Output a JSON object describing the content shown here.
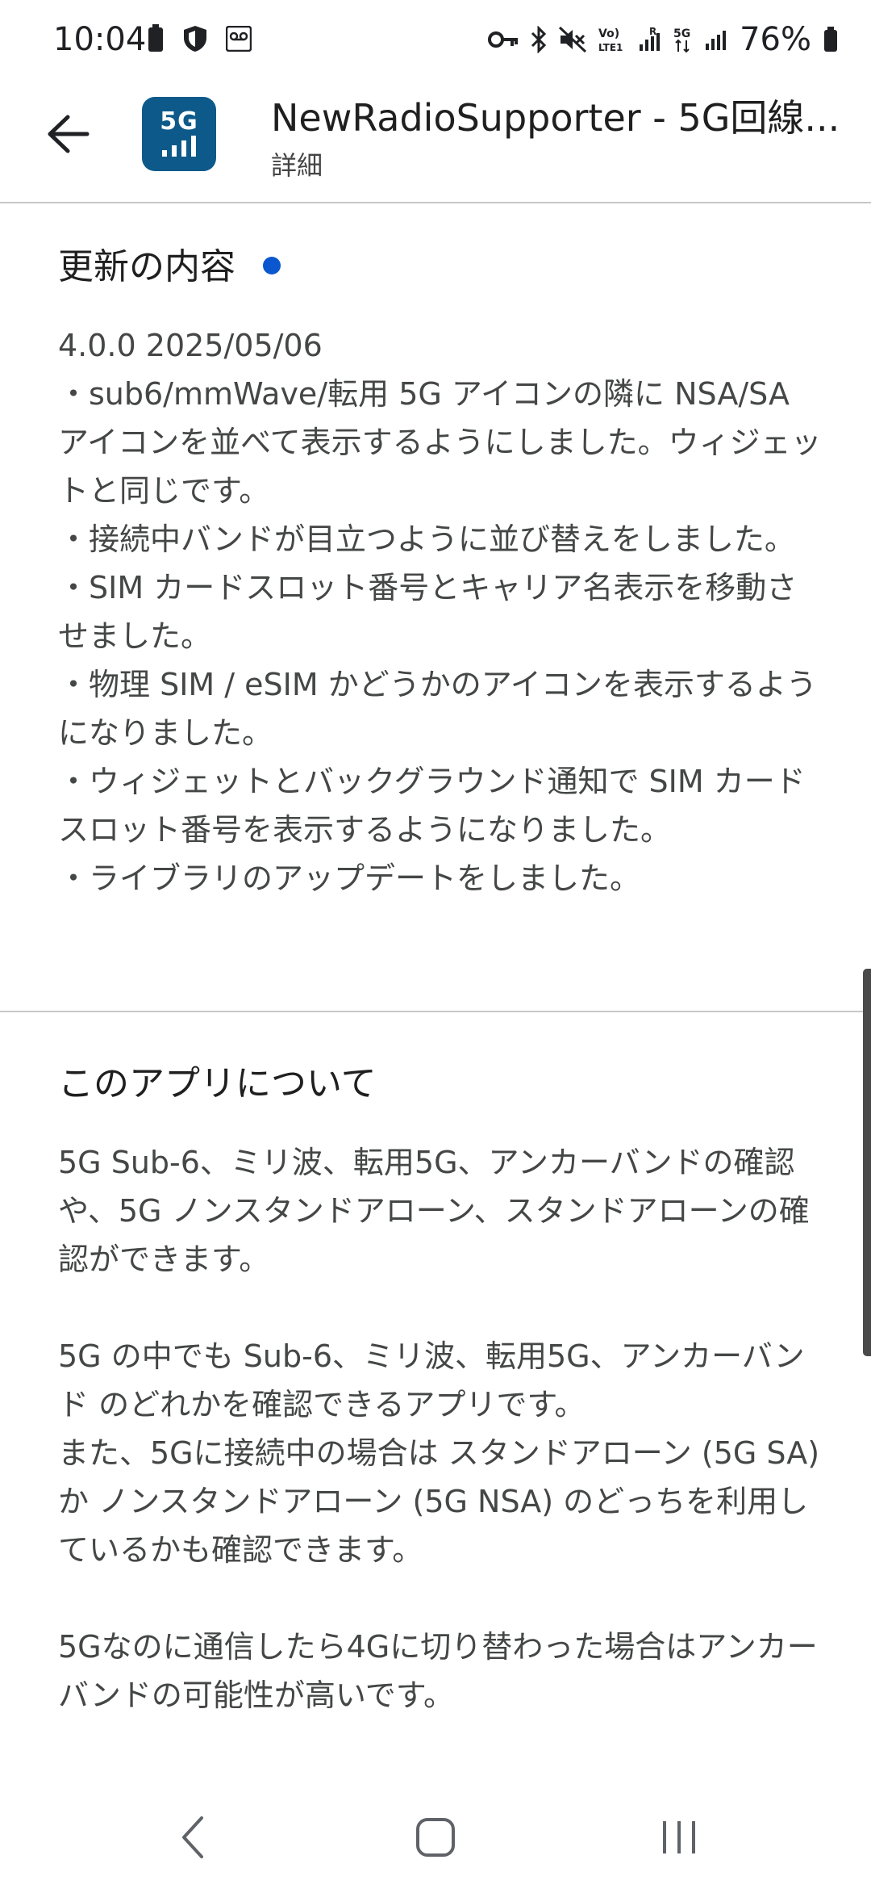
{
  "status_bar": {
    "time": "10:04",
    "battery_percent": "76%",
    "left_icons": [
      "battery-icon",
      "shield-icon",
      "voicemail-icon"
    ],
    "right_icons": [
      "key-icon",
      "bluetooth-icon",
      "mute-icon",
      "volte-icon",
      "signal-icon",
      "5g-data-icon",
      "signal-icon",
      "battery-icon"
    ]
  },
  "header": {
    "app_name": "NewRadioSupporter - 5G回線...",
    "subtitle": "詳細",
    "app_icon_label": "5G"
  },
  "whats_new": {
    "title": "更新の内容",
    "body": "4.0.0 2025/05/06\n・sub6/mmWave/転用 5G アイコンの隣に NSA/SA アイコンを並べて表示するようにしました。ウィジェットと同じです。\n・接続中バンドが目立つように並び替えをしました。\n・SIM カードスロット番号とキャリア名表示を移動させました。\n・物理 SIM / eSIM かどうかのアイコンを表示するようになりました。\n・ウィジェットとバックグラウンド通知で SIM カードスロット番号を表示するようになりました。\n・ライブラリのアップデートをしました。"
  },
  "about": {
    "title": "このアプリについて",
    "paragraph1": "5G Sub-6、ミリ波、転用5G、アンカーバンドの確認や、5G ノンスタンドアローン、スタンドアローンの確認ができます。",
    "paragraph2": "5G の中でも Sub-6、ミリ波、転用5G、アンカーバンド のどれかを確認できるアプリです。\nまた、5Gに接続中の場合は スタンドアローン (5G SA) か ノンスタンドアローン (5G NSA) のどっちを利用しているかも確認できます。",
    "paragraph3": "5Gなのに通信したら4Gに切り替わった場合はアンカーバンドの可能性が高いです。"
  },
  "colors": {
    "accent_dot": "#0b57d0",
    "app_icon_bg": "#0d5a8a"
  }
}
